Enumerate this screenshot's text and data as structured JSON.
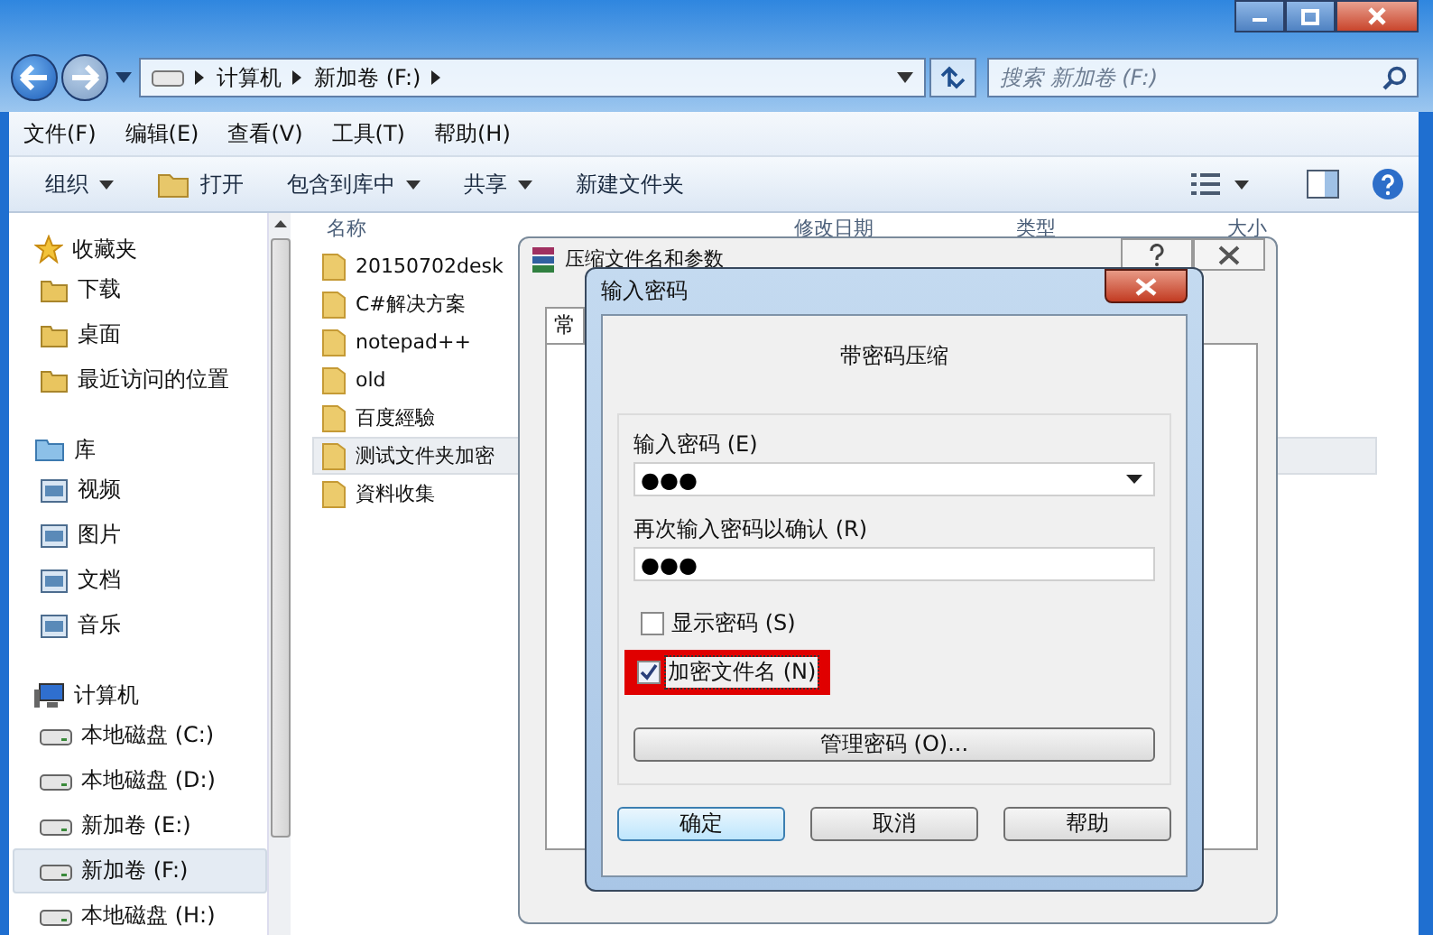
{
  "address_bar": {
    "path": [
      "计算机",
      "新加卷 (F:)"
    ]
  },
  "search": {
    "placeholder": "搜索 新加卷 (F:)"
  },
  "menu": [
    "文件(F)",
    "编辑(E)",
    "查看(V)",
    "工具(T)",
    "帮助(H)"
  ],
  "toolbar": [
    {
      "label": "组织",
      "kind": "menu"
    },
    {
      "label": "打开",
      "kind": "open"
    },
    {
      "label": "包含到库中",
      "kind": "menu"
    },
    {
      "label": "共享",
      "kind": "menu"
    },
    {
      "label": "新建文件夹",
      "kind": "plain"
    }
  ],
  "sidebar": {
    "groups": [
      {
        "label": "收藏夹",
        "kind": "favorites",
        "children": [
          {
            "label": "下载",
            "selected": false
          },
          {
            "label": "桌面",
            "selected": false
          },
          {
            "label": "最近访问的位置",
            "selected": false
          }
        ]
      },
      {
        "label": "库",
        "kind": "libraries",
        "children": [
          {
            "label": "视频",
            "selected": false
          },
          {
            "label": "图片",
            "selected": false
          },
          {
            "label": "文档",
            "selected": false
          },
          {
            "label": "音乐",
            "selected": false
          }
        ]
      },
      {
        "label": "计算机",
        "kind": "computer",
        "children": [
          {
            "label": "本地磁盘 (C:)",
            "selected": false
          },
          {
            "label": "本地磁盘 (D:)",
            "selected": false
          },
          {
            "label": "新加卷 (E:)",
            "selected": false
          },
          {
            "label": "新加卷 (F:)",
            "selected": true
          },
          {
            "label": "本地磁盘 (H:)",
            "selected": false
          }
        ]
      }
    ]
  },
  "file_list": {
    "columns": [
      "名称",
      "修改日期",
      "类型",
      "大小"
    ],
    "items": [
      {
        "name": "20150702desk",
        "selected": false
      },
      {
        "name": "C#解决方案",
        "selected": false
      },
      {
        "name": "notepad++",
        "selected": false
      },
      {
        "name": "old",
        "selected": false
      },
      {
        "name": "百度經驗",
        "selected": false
      },
      {
        "name": "测试文件夹加密",
        "selected": true
      },
      {
        "name": "資料收集",
        "selected": false
      }
    ]
  },
  "archive_dialog": {
    "title": "压缩文件名和参数",
    "tab": "常"
  },
  "password_dialog": {
    "title": "输入密码",
    "heading": "带密码压缩",
    "password_label": "输入密码 (E)",
    "password": "●●●",
    "confirm_label": "再次输入密码以确认 (R)",
    "confirm": "●●●",
    "options": [
      {
        "label": "显示密码 (S)",
        "checked": false,
        "highlighted": false
      },
      {
        "label": "加密文件名 (N)",
        "checked": true,
        "highlighted": true
      }
    ],
    "manage_button": "管理密码 (O)...",
    "buttons": [
      {
        "label": "确定",
        "default": true
      },
      {
        "label": "取消",
        "default": false
      },
      {
        "label": "帮助",
        "default": false
      }
    ]
  }
}
